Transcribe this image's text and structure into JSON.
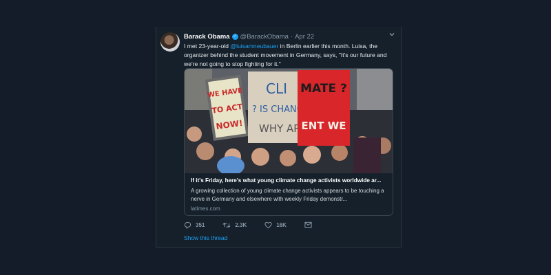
{
  "tweet": {
    "author_name": "Barack Obama",
    "author_handle": "@BarackObama",
    "separator": "·",
    "date": "Apr 22",
    "text_before_mention": "I met 23-year-old ",
    "mention": "@luisamneubauer",
    "text_after_mention": " in Berlin earlier this month. Luisa, the organizer behind the student movement in Germany, says, \"It's our future and we're not going to stop fighting for it.\""
  },
  "card": {
    "title": "If it's Friday, here's what young climate change activists worldwide ar...",
    "description": "A growing collection of young climate change activists appears to be touching a nerve in Germany and elsewhere with weekly Friday demonstr...",
    "domain": "latimes.com",
    "image": {
      "sign_left": [
        "WE HAVE",
        "TO ACT",
        "NOW!"
      ],
      "sign_middle": [
        "CLI",
        "? IS CHANGING",
        "WHY AR"
      ],
      "sign_right": [
        "MATE ?",
        "ENT WE"
      ]
    }
  },
  "actions": {
    "replies": "351",
    "retweets": "2.3K",
    "likes": "16K"
  },
  "show_thread": "Show this thread",
  "colors": {
    "background": "#151c29",
    "tweet_bg": "#15202b",
    "accent": "#1da1f2",
    "muted": "#8899a6",
    "sign_red": "#d8262b"
  },
  "icons": {
    "reply": "reply-icon",
    "retweet": "retweet-icon",
    "like": "heart-icon",
    "dm": "envelope-icon",
    "caret": "chevron-down-icon",
    "verified": "verified-badge-icon"
  }
}
